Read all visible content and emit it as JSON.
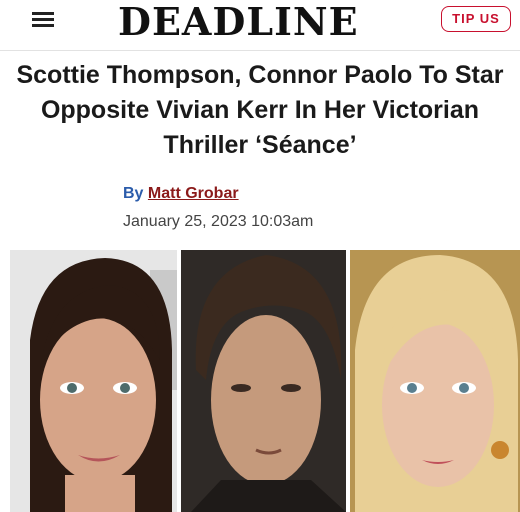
{
  "header": {
    "logo": "DEADLINE",
    "tip_button": "TIP US"
  },
  "article": {
    "headline": "Scottie Thompson, Connor Paolo To Star Opposite Vivian Kerr In Her Victorian Thriller ‘Séance’",
    "byline_prefix": "By",
    "author": "Matt Grobar",
    "date": "January 25, 2023 10:03am"
  },
  "photos": [
    {
      "icon": "woman-dark-hair-portrait"
    },
    {
      "icon": "man-portrait"
    },
    {
      "icon": "woman-blonde-portrait"
    }
  ],
  "colors": {
    "tip_border": "#c8102e",
    "byline_blue": "#2b5cab",
    "author_link": "#8b1a1a"
  }
}
